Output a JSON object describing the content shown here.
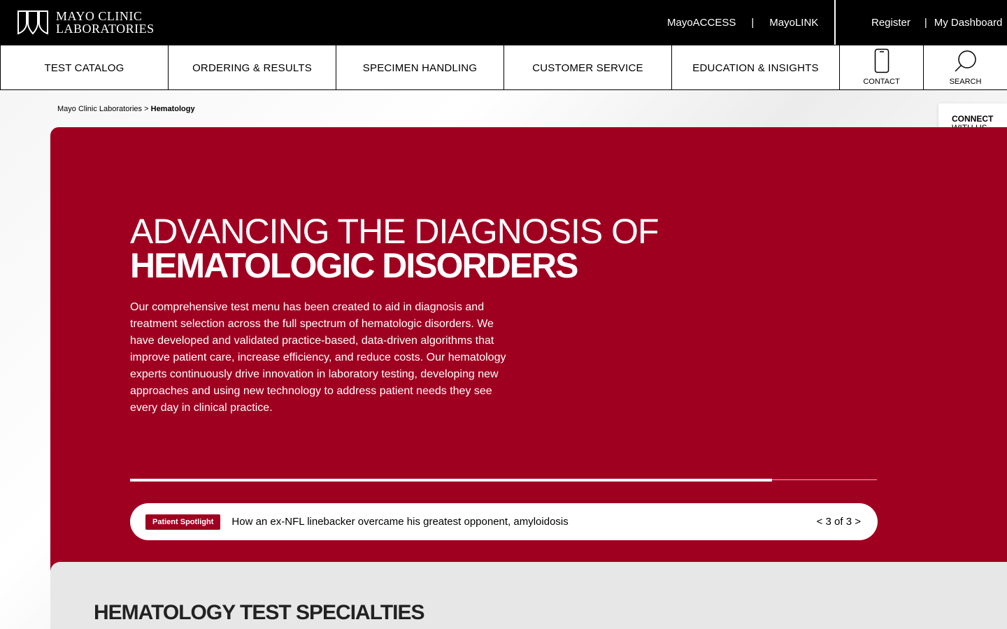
{
  "header": {
    "logo_line1": "MAYO CLINIC",
    "logo_line2": "LABORATORIES",
    "links_left": [
      "MayoACCESS",
      "MayoLINK"
    ],
    "links_right": [
      "Register",
      "My Dashboard"
    ],
    "separator": "|"
  },
  "nav": {
    "items": [
      "TEST CATALOG",
      "ORDERING & RESULTS",
      "SPECIMEN HANDLING",
      "CUSTOMER SERVICE",
      "EDUCATION & INSIGHTS"
    ],
    "contact_label": "CONTACT",
    "search_label": "SEARCH"
  },
  "breadcrumb": {
    "root": "Mayo Clinic Laboratories",
    "separator": ">",
    "current": "Hematology"
  },
  "connect": {
    "line1": "CONNECT",
    "line2": "WITH US"
  },
  "hero": {
    "title_line1": "ADVANCING THE DIAGNOSIS OF",
    "title_line2": "HEMATOLOGIC DISORDERS",
    "body": "Our comprehensive test menu has been created to aid in diagnosis and treatment selection across the full spectrum of hematologic disorders. We have developed and validated practice-based, data-driven algorithms that improve patient care, increase efficiency, and reduce costs. Our hematology experts continuously drive innovation in laboratory testing, developing new approaches and using new technology to address patient needs they see every day in clinical practice.",
    "progress": 0.86,
    "spotlight": {
      "badge": "Patient Spotlight",
      "text": "How an ex-NFL linebacker overcame his greatest opponent, amyloidosis",
      "pager": "< 3 of 3 >"
    },
    "accent_color": "#a00020"
  },
  "specialties": {
    "title": "HEMATOLOGY TEST SPECIALTIES"
  }
}
